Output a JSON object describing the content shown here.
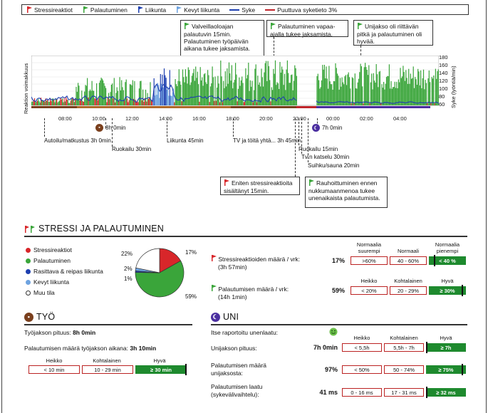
{
  "legend": [
    {
      "label": "Stressireaktiot",
      "color": "#d8262a",
      "kind": "flag"
    },
    {
      "label": "Palautuminen",
      "color": "#3aa53a",
      "kind": "flag"
    },
    {
      "label": "Liikunta",
      "color": "#1d3fb0",
      "kind": "flag"
    },
    {
      "label": "Kevyt liikunta",
      "color": "#6ea3e0",
      "kind": "flag"
    },
    {
      "label": "Syke",
      "color": "#1d3fb0",
      "kind": "line"
    },
    {
      "label": "Puuttuva syketieto 3%",
      "color": "#c0252b",
      "kind": "line"
    }
  ],
  "callouts": [
    {
      "text": "Valveillaoloajan palautuvin 15min. Palautuminen työpäivän aikana tukee jaksamista.",
      "type": "recovery"
    },
    {
      "text": "Palautuminen vapaa-ajalla tukee jaksamista.",
      "type": "recovery"
    },
    {
      "text": "Unijakso oli riittävän pitkä ja palautuminen oli hyvää.",
      "type": "recovery"
    },
    {
      "text": "Eniten stressireaktioita sisältänyt 15min.",
      "type": "stress"
    },
    {
      "text": "Rauhoittuminen ennen nukkumaanmenoa tukee unenaikaista palautumista.",
      "type": "recovery"
    }
  ],
  "chart": {
    "ylabel_left": "Reaktion voimakkuus",
    "ylabel_right": "Syke (lyöntiä/min)",
    "right_ticks": [
      "180",
      "160",
      "140",
      "120",
      "100",
      "80",
      "60"
    ],
    "x_ticks": [
      "08:00",
      "10:00",
      "12:00",
      "14:00",
      "16:00",
      "18:00",
      "20:00",
      "22:00",
      "00:00",
      "02:00",
      "04:00"
    ]
  },
  "annotations": {
    "work": "8h 0min",
    "sleep": "7h 0min",
    "commute": "Autoilu/matkustus 3h 0min",
    "meal1": "Ruokailu 30min",
    "exercise": "Liikunta 45min",
    "tv_work": "TV ja töitä yhtä... 3h 45min",
    "meal2": "Ruokailu 15min",
    "tv": "Tv:n katselu 30min",
    "sauna": "Suihku/sauna 20min"
  },
  "stress_section": {
    "title": "STRESSI JA PALAUTUMINEN",
    "pie_legend": [
      {
        "label": "Stressireaktiot",
        "color": "#d8262a"
      },
      {
        "label": "Palautuminen",
        "color": "#3aa53a"
      },
      {
        "label": "Rasittava & reipas liikunta",
        "color": "#1d3fb0"
      },
      {
        "label": "Kevyt liikunta",
        "color": "#6ea3e0"
      },
      {
        "label": "Muu tila",
        "color": "#ffffff"
      }
    ],
    "pie_pcts": {
      "stress": "17%",
      "recovery": "59%",
      "other": "22%",
      "exercise": "2%",
      "light": "1%"
    },
    "pie_values": {
      "stress": 17,
      "recovery": 59,
      "exercise": 1,
      "light": 2,
      "other": 22
    },
    "stress_row": {
      "label": "Stressireaktioiden määrä / vrk:",
      "sub": "(3h 57min)",
      "value": "17%",
      "headers": [
        "Normaalia suurempi",
        "Normaali",
        "Normaalia pienempi"
      ],
      "boxes": [
        ">60%",
        "40 - 60%",
        "< 40 %"
      ]
    },
    "recovery_row": {
      "label": "Palautumisen määrä / vrk:",
      "sub": "(14h 1min)",
      "value": "59%",
      "headers": [
        "Heikko",
        "Kohtalainen",
        "Hyvä"
      ],
      "boxes": [
        "< 20%",
        "20 - 29%",
        "≥ 30%"
      ]
    }
  },
  "work_section": {
    "title": "TYÖ",
    "length_label": "Työjakson pituus:",
    "length_value": "8h 0min",
    "recovery_label": "Palautumisen määrä työjakson aikana:",
    "recovery_value": "3h 10min",
    "headers": [
      "Heikko",
      "Kohtalainen",
      "Hyvä"
    ],
    "boxes": [
      "< 10 min",
      "10 - 29 min",
      "≥ 30 min"
    ]
  },
  "sleep_section": {
    "title": "UNI",
    "self_reported": "Itse raportoitu unenlaatu:",
    "headers": [
      "Heikko",
      "Kohtalainen",
      "Hyvä"
    ],
    "rows": [
      {
        "label": "Unijakson pituus:",
        "value": "7h 0min",
        "boxes": [
          "< 5,5h",
          "5,5h - 7h",
          "≥ 7h"
        ]
      },
      {
        "label": "Palautumisen määrä unijaksosta:",
        "value": "97%",
        "boxes": [
          "< 50%",
          "50 - 74%",
          "≥ 75%"
        ]
      },
      {
        "label": "Palautumisen laatu (sykevälivaihtelu):",
        "value": "41 ms",
        "boxes": [
          "0 - 16 ms",
          "17 - 31 ms",
          "≥ 32 ms"
        ]
      }
    ]
  }
}
